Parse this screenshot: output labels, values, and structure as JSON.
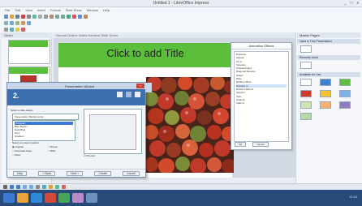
{
  "window": {
    "title": "Untitled 1 - LibreOffice Impress"
  },
  "menu": [
    "File",
    "Edit",
    "View",
    "Insert",
    "Format",
    "Slide Show",
    "Window",
    "Help"
  ],
  "editor_header": "Normal  Outline  Notes  Handout  Slide Sorter",
  "slide": {
    "title_placeholder": "Click to add Title"
  },
  "slides_pane_label": "Slides",
  "animation_panel": {
    "title": "Animation Effects",
    "items": [
      "Entrance",
      "Appear",
      "Fly In",
      "Venetian",
      "Checkerboard",
      "Diagonal Squares",
      "Wheel",
      "Wipe",
      "Random Bars",
      "Dissolve In",
      "Random Effects",
      "Spiral In",
      "Split",
      "Stretchy",
      "Fade In"
    ],
    "selected_index": 9,
    "ok": "OK",
    "cancel": "Cancel"
  },
  "master_pane": {
    "title": "Master Pages",
    "used": "Used in This Presentation",
    "recent": "Recently Used",
    "available": "Available for Use",
    "colors": [
      "#ffffff",
      "#3f7fd0",
      "#5bbf3c",
      "#d23b2b",
      "#f4c430",
      "#7fb0e8",
      "#cfe3b0",
      "#f6b26b",
      "#8e7cc3",
      "#b6d7a8"
    ]
  },
  "dialog": {
    "title": "Presentation Wizard",
    "step": "2.",
    "select_label": "Select a slide design",
    "category": "Presentation Backgrounds",
    "list": [
      "<Original>",
      "Blue Border",
      "Dark Blue",
      "Grey",
      "Gradient",
      "Green Line"
    ],
    "selected_index": 0,
    "output_label": "Select an output medium",
    "options": [
      "Original",
      "Overhead sheet",
      "Paper",
      "Screen",
      "Slide"
    ],
    "preview_label": "Preview",
    "buttons": [
      "Help",
      "< Back",
      "Next >",
      "Create",
      "Cancel"
    ]
  },
  "taskbar": {
    "time": "12:10"
  }
}
